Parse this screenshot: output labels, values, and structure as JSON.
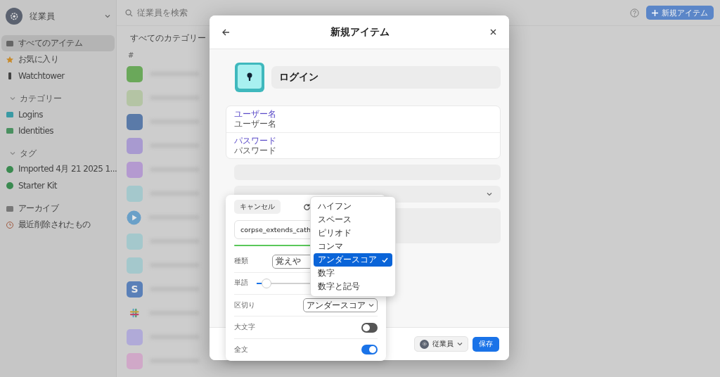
{
  "sidebar": {
    "account": "従業員",
    "items": [
      {
        "label": "すべてのアイテム",
        "selected": true
      },
      {
        "label": "お気に入り",
        "selected": false
      },
      {
        "label": "Watchtower",
        "selected": false
      }
    ],
    "sections": [
      {
        "title": "カテゴリー",
        "items": [
          {
            "label": "Logins",
            "selected": false
          },
          {
            "label": "Identities",
            "selected": false
          }
        ]
      },
      {
        "title": "タグ",
        "items": [
          {
            "label": "Imported 4月 21 2025 1...",
            "selected": false
          },
          {
            "label": "Starter Kit",
            "selected": false
          }
        ]
      }
    ],
    "bottom_items": [
      {
        "label": "アーカイブ",
        "selected": false
      },
      {
        "label": "最近削除されたもの",
        "selected": false
      }
    ]
  },
  "toolbar": {
    "search_placeholder": "従業員を検索",
    "new_button": "新規アイテム"
  },
  "list": {
    "filter": "すべてのカテゴリー",
    "section": "#",
    "items": [
      {
        "color": "#6aa85a"
      },
      {
        "color": "#b4c4a4"
      },
      {
        "color": "#5a7aa8"
      },
      {
        "color": "#a89ad0"
      },
      {
        "color": "#b49ad0"
      },
      {
        "color": "#a4c8cc"
      },
      {
        "color": "#6aa0c8",
        "kind": "play"
      },
      {
        "color": "#a4c8cc"
      },
      {
        "color": "#a4c8cc"
      },
      {
        "color": "#5a80b8",
        "label": "S"
      },
      {
        "kind": "slack"
      },
      {
        "color": "#b0aad8"
      },
      {
        "color": "#d0a8c8"
      }
    ]
  },
  "modal": {
    "title": "新規アイテム",
    "item_name": "ログイン",
    "fields": [
      {
        "label": "ユーザー名",
        "placeholder": "ユーザー名"
      },
      {
        "label": "パスワード",
        "placeholder": "パスワード"
      }
    ],
    "vault": "従業員",
    "save": "保存"
  },
  "generator": {
    "cancel": "キャンセル",
    "password": "corpse_extends_cath",
    "rows": [
      {
        "kind": "select",
        "label": "種類",
        "value": "覚えや"
      },
      {
        "kind": "slider",
        "label": "単語",
        "level": 0.1
      },
      {
        "kind": "select",
        "label": "区切り",
        "value": "アンダースコア"
      },
      {
        "kind": "toggle",
        "label": "大文字",
        "on": false
      },
      {
        "kind": "toggle",
        "label": "全文",
        "on": true
      }
    ]
  },
  "separator_menu": [
    {
      "label": "ハイフン",
      "selected": false
    },
    {
      "label": "スペース",
      "selected": false
    },
    {
      "label": "ピリオド",
      "selected": false
    },
    {
      "label": "コンマ",
      "selected": false
    },
    {
      "label": "アンダースコア",
      "selected": true
    },
    {
      "label": "数字",
      "selected": false
    },
    {
      "label": "数字と記号",
      "selected": false
    }
  ]
}
